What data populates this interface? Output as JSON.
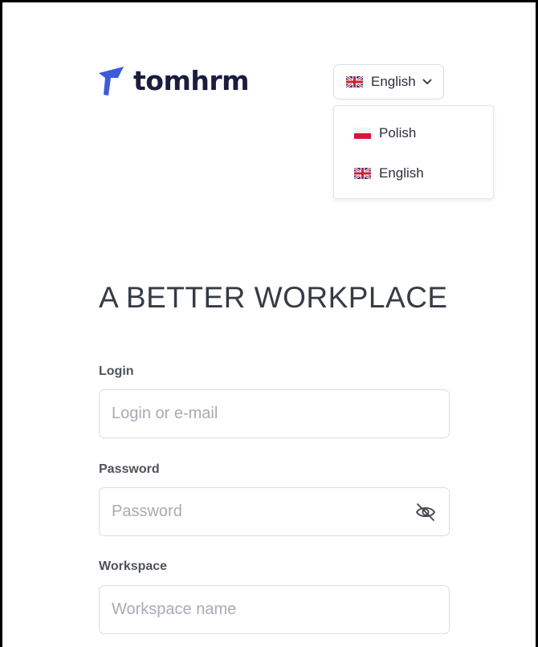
{
  "brand": {
    "name": "tomhrm",
    "accent_color": "#3b5bdb",
    "text_color": "#1a1d3e"
  },
  "language_selector": {
    "selected": "English",
    "selected_icon": "uk-flag-icon",
    "options": [
      {
        "label": "Polish",
        "icon": "poland-flag-icon"
      },
      {
        "label": "English",
        "icon": "uk-flag-icon"
      }
    ]
  },
  "headline": "A BETTER WORKPLACE",
  "form": {
    "login": {
      "label": "Login",
      "placeholder": "Login or e-mail",
      "value": ""
    },
    "password": {
      "label": "Password",
      "placeholder": "Password",
      "value": "",
      "toggle_icon": "eye-off-icon"
    },
    "workspace": {
      "label": "Workspace",
      "placeholder": "Workspace name",
      "value": ""
    }
  }
}
